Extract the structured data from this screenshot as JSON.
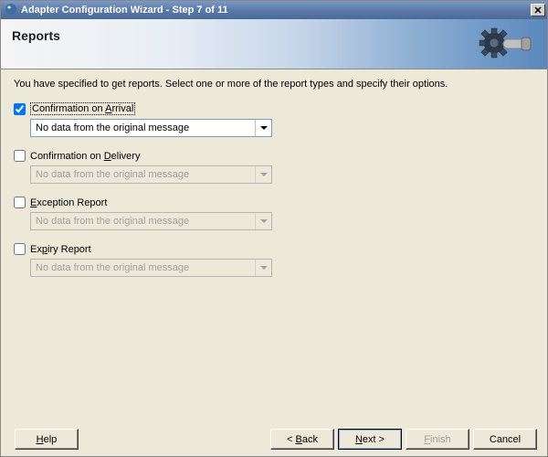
{
  "window": {
    "title": "Adapter Configuration Wizard - Step 7 of 11"
  },
  "header": {
    "title": "Reports"
  },
  "intro": "You have specified to get reports.  Select one or more of the report types and specify their options.",
  "options": {
    "arrival": {
      "label_pre": "Confirmation on ",
      "label_accel": "A",
      "label_post": "rrival",
      "checked": true,
      "combo": "No data from the original message",
      "enabled": true
    },
    "delivery": {
      "label_pre": "Confirmation on ",
      "label_accel": "D",
      "label_post": "elivery",
      "checked": false,
      "combo": "No data from the original message",
      "enabled": false
    },
    "exception": {
      "label_pre": "",
      "label_accel": "E",
      "label_post": "xception Report",
      "checked": false,
      "combo": "No data from the original message",
      "enabled": false
    },
    "expiry": {
      "label_pre": "Ex",
      "label_accel": "p",
      "label_post": "iry Report",
      "checked": false,
      "combo": "No data from the original message",
      "enabled": false
    }
  },
  "footer": {
    "help": "Help",
    "back_accel": "B",
    "back_rest": "ack",
    "next_accel": "N",
    "next_rest": "ext >",
    "back_prefix": "< ",
    "finish": "Finish",
    "finish_accel": "F",
    "finish_rest": "inish",
    "cancel": "Cancel"
  }
}
